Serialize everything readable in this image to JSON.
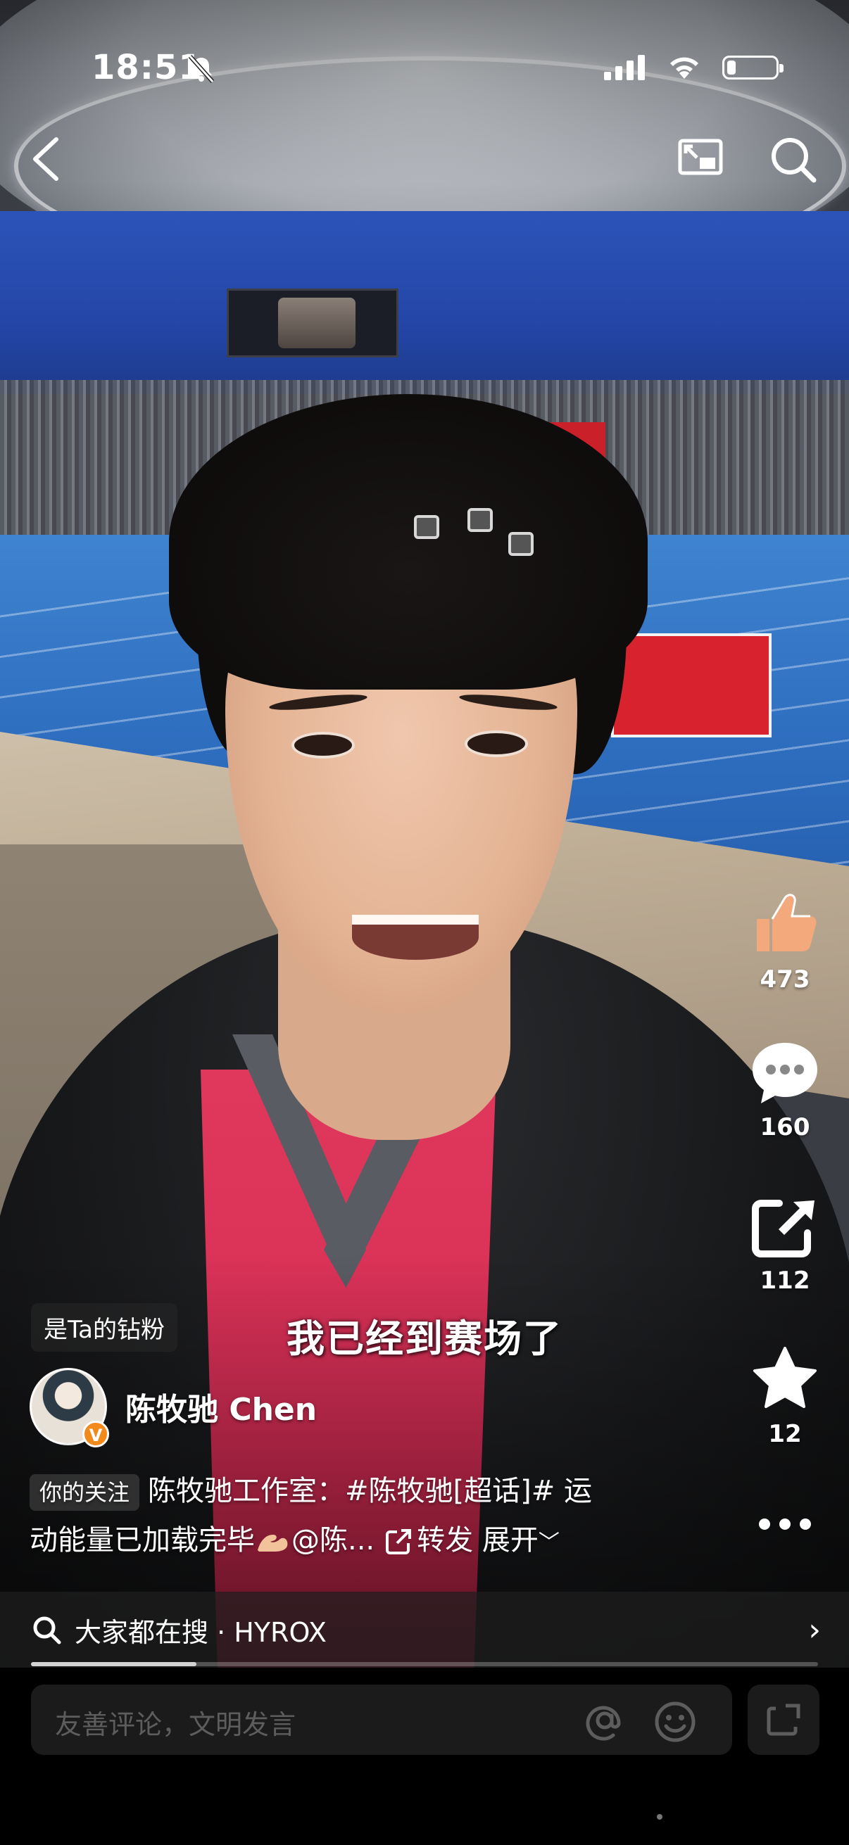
{
  "status_bar": {
    "time": "18:51",
    "battery_level": 0.18
  },
  "video": {
    "caption": "我已经到赛场了",
    "progress": 0.21
  },
  "actions": {
    "likes": "473",
    "comments": "160",
    "shares": "112",
    "favorites": "12"
  },
  "fan_tag": "是Ta的钻粉",
  "author": {
    "name": "陈牧驰 Chen",
    "badge": "V"
  },
  "description": {
    "follow_tag": "你的关注",
    "line1": "陈牧驰工作室：#陈牧驰[超话]# 运",
    "line2": "动能量已加载完毕",
    "mention": "@陈...",
    "repost": "转发",
    "expand": "展开"
  },
  "search_suggestion": {
    "prefix": "大家都在搜 · ",
    "term": "HYROX"
  },
  "comment": {
    "placeholder": "友善评论，文明发言"
  },
  "colors": {
    "like": "#f4a97c",
    "verified": "#f28a1b",
    "shirt": "#d82d55"
  }
}
